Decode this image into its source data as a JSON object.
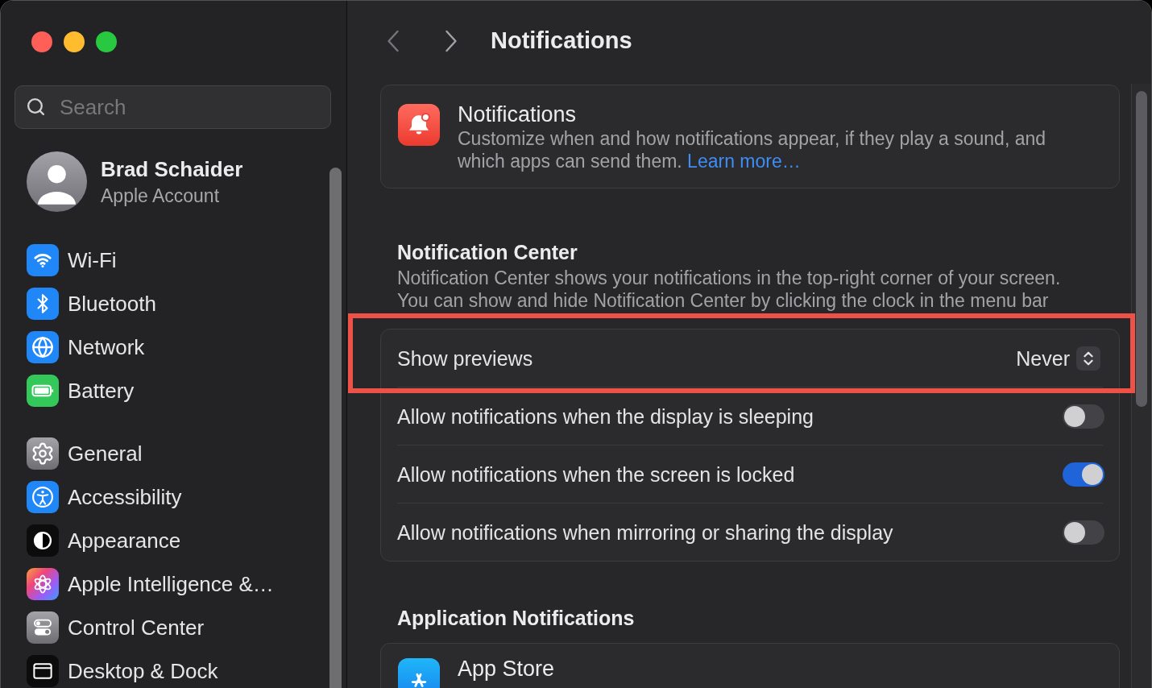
{
  "window": {
    "title": "Notifications"
  },
  "sidebar": {
    "search": {
      "placeholder": "Search"
    },
    "account": {
      "name": "Brad Schaider",
      "subtitle": "Apple Account"
    },
    "groups": [
      {
        "items": [
          {
            "label": "Wi-Fi",
            "selected": false
          },
          {
            "label": "Bluetooth",
            "selected": false
          },
          {
            "label": "Network",
            "selected": false
          },
          {
            "label": "Battery",
            "selected": false
          }
        ]
      },
      {
        "items": [
          {
            "label": "General",
            "selected": false
          },
          {
            "label": "Accessibility",
            "selected": false
          },
          {
            "label": "Appearance",
            "selected": false
          },
          {
            "label": "Apple Intelligence &…",
            "selected": false
          },
          {
            "label": "Control Center",
            "selected": false
          },
          {
            "label": "Desktop & Dock",
            "selected": false
          }
        ]
      }
    ]
  },
  "header_card": {
    "title": "Notifications",
    "description": "Customize when and how notifications appear, if they play a sound, and which apps can send them.",
    "link": "Learn more…"
  },
  "notification_center": {
    "heading": "Notification Center",
    "description_lines": [
      "Notification Center shows your notifications in the top-right corner of your screen.",
      "You can show and hide Notification Center by clicking the clock in the menu bar"
    ],
    "rows": [
      {
        "kind": "select",
        "label": "Show previews",
        "value": "Never",
        "highlighted": true
      },
      {
        "kind": "toggle",
        "label": "Allow notifications when the display is sleeping",
        "on": false,
        "highlighted": false
      },
      {
        "kind": "toggle",
        "label": "Allow notifications when the screen is locked",
        "on": true,
        "highlighted": false
      },
      {
        "kind": "toggle",
        "label": "Allow notifications when mirroring or sharing the display",
        "on": false,
        "highlighted": false
      }
    ]
  },
  "application_notifications": {
    "heading": "Application Notifications",
    "apps": [
      {
        "name": "App Store"
      }
    ]
  }
}
